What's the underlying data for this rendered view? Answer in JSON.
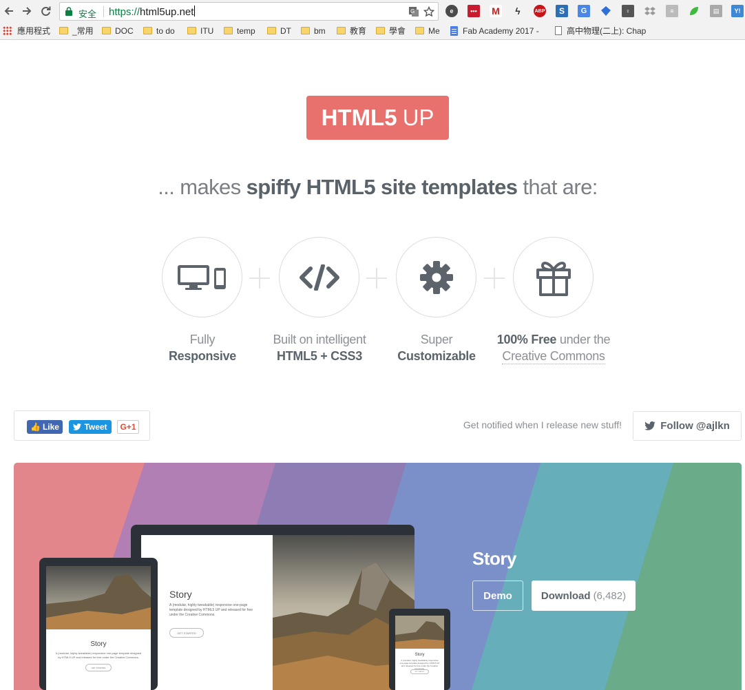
{
  "browser": {
    "secure_label": "安全",
    "url_scheme": "https://",
    "url_host": "html5up.net",
    "extensions": [
      "evernote-icon",
      "lastpass-icon",
      "gmail-icon",
      "bolt-icon",
      "adblock-plus-icon",
      "s-icon",
      "translate-icon",
      "diamond-icon",
      "lightbulb-icon",
      "dropbox-icon",
      "reader-icon",
      "leaf-icon",
      "tab-icon",
      "yahoo-icon"
    ],
    "bookmarks": {
      "apps": "應用程式",
      "items": [
        "_常用",
        "DOC",
        "to do",
        "ITU",
        "temp",
        "DT",
        "bm",
        "教育",
        "學會",
        "Me"
      ],
      "fab": "Fab Academy 2017 -",
      "physics": "高中物理(二上): Chap"
    }
  },
  "page": {
    "logo_bold": "HTML5",
    "logo_light": "UP",
    "tagline_pre": "... makes ",
    "tagline_bold": "spiffy HTML5 site templates",
    "tagline_post": " that are:",
    "features": [
      {
        "icon": "devices-icon",
        "line1": "Fully",
        "line2": "Responsive"
      },
      {
        "icon": "code-icon",
        "line1": "Built on intelligent",
        "line2": "HTML5 + CSS3"
      },
      {
        "icon": "gear-icon",
        "line1": "Super",
        "line2": "Customizable"
      },
      {
        "icon": "gift-icon",
        "line1_bold": "100% Free",
        "line1_rest": " under the",
        "line2": "Creative Commons"
      }
    ],
    "share": {
      "like": "Like",
      "tweet": "Tweet",
      "gplus": "G+1"
    },
    "notify_text": "Get notified when I release new stuff!",
    "follow_label": "Follow @ajlkn"
  },
  "hero": {
    "title": "Story",
    "demo_label": "Demo",
    "download_label": "Download",
    "download_count": "(6,482)",
    "mock_title": "Story",
    "mock_text": "A (modular, highly tweakable) responsive one-page template designed by HTML5 UP and released for free under the Creative Commons.",
    "mock_button": "GET STARTED",
    "colors": [
      "#e3868b",
      "#b27fb5",
      "#8e7db4",
      "#7b90c9",
      "#67aebb",
      "#6aab8a"
    ]
  }
}
